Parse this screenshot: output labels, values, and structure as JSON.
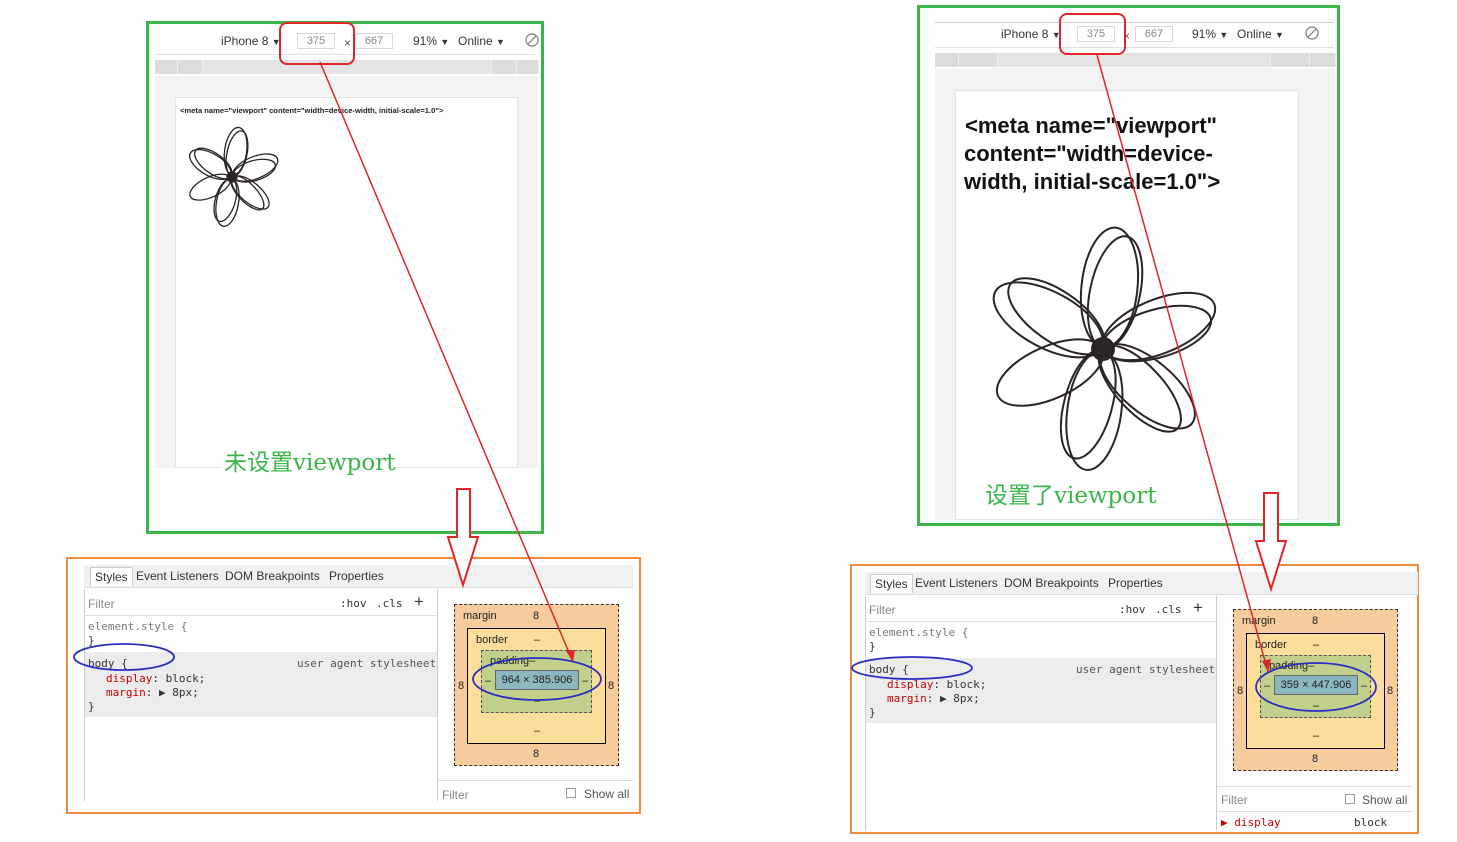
{
  "toolbar": {
    "device": "iPhone 8",
    "width": "375",
    "height": "667",
    "times": "×",
    "zoom": "91%",
    "network": "Online",
    "dropdown": "▼"
  },
  "left": {
    "meta_text": "<meta name=\"viewport\" content=\"width=device-width, initial-scale=1.0\">",
    "caption": "未设置viewport"
  },
  "right": {
    "meta_line1": "<meta name=\"viewport\"",
    "meta_line2": "content=\"width=device-",
    "meta_line3": "width, initial-scale=1.0\">",
    "caption": "设置了viewport"
  },
  "devtools": {
    "tabs": [
      "Styles",
      "Event Listeners",
      "DOM Breakpoints",
      "Properties"
    ],
    "filter_placeholder": "Filter",
    "hov": ":hov",
    "cls": ".cls",
    "plus": "+",
    "element_style": "element.style {",
    "close_brace": "}",
    "body_selector": "body {",
    "source": "user agent stylesheet",
    "display_prop": "display",
    "display_val": ": block;",
    "margin_prop": "margin",
    "margin_val": ": ▶ 8px;",
    "show_all": "Show all",
    "computed_display_prop": "▶ display",
    "computed_display_val": "block"
  },
  "boxmodel": {
    "margin_label": "margin",
    "border_label": "border",
    "padding_label": "padding–",
    "margin_value": "8",
    "dash": "–",
    "left_content": "964 × 385.906",
    "right_content": "359 × 447.906"
  },
  "colors": {
    "green_frame": "#3bb54a",
    "orange_frame": "#f28a3c",
    "annotation_red": "#e0262a",
    "annotation_blue": "#2b2fbf"
  }
}
